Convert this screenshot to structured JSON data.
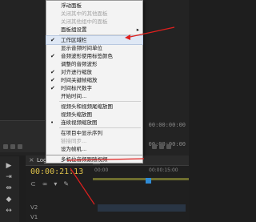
{
  "menu": {
    "items": [
      {
        "label": "浮动面板",
        "checked": false,
        "disabled": false
      },
      {
        "label": "关闭其中的其他面板",
        "checked": false,
        "disabled": true
      },
      {
        "label": "关闭其他组中的面板",
        "checked": false,
        "disabled": true
      },
      {
        "label": "面板组设置",
        "checked": false,
        "disabled": false,
        "submenu": true
      },
      {
        "label": "工作区域栏",
        "checked": true,
        "disabled": false,
        "highlight": true
      },
      {
        "label": "显示音频时间单位",
        "checked": false,
        "disabled": false
      },
      {
        "label": "音频波形使用标签颜色",
        "checked": true,
        "disabled": false
      },
      {
        "label": "调整的音频波形",
        "checked": false,
        "disabled": false
      },
      {
        "label": "对齐进行缩放",
        "checked": true,
        "disabled": false
      },
      {
        "label": "时间关键帧缩放",
        "checked": true,
        "disabled": false
      },
      {
        "label": "时间标尺数字",
        "checked": true,
        "disabled": false
      },
      {
        "label": "开始时间...",
        "checked": false,
        "disabled": false
      },
      {
        "label": "视频头和视频尾缩放图",
        "checked": false,
        "disabled": false
      },
      {
        "label": "视频头缩放图",
        "checked": false,
        "disabled": false
      },
      {
        "label": "连续视频缩放图",
        "checked": false,
        "disabled": false,
        "radio": true
      },
      {
        "label": "在项目中显示序列",
        "checked": false,
        "disabled": false
      },
      {
        "label": "链接同步...",
        "checked": false,
        "disabled": true
      },
      {
        "label": "设为帧机...",
        "checked": false,
        "disabled": false
      },
      {
        "label": "多机位音频跟随视频",
        "checked": false,
        "disabled": false
      }
    ],
    "submenu_arrow": "▸"
  },
  "sequence": {
    "close_icon": "×",
    "title": "Logo version",
    "menu_icon": "≡",
    "timecode": "00:00:21:13",
    "ruler_labels": [
      "00:00",
      "00:00:15:00"
    ],
    "track_labels": [
      "V2",
      "V1"
    ]
  },
  "background": {
    "right_timecode_top": "00:00:00:00",
    "right_timecode_bottom": "00:00:00:00"
  },
  "colors": {
    "menu_bg": "#f3f3f3",
    "timecode": "#e0c34a",
    "annotation": "#e0201e",
    "playhead": "#2f8bd6"
  }
}
